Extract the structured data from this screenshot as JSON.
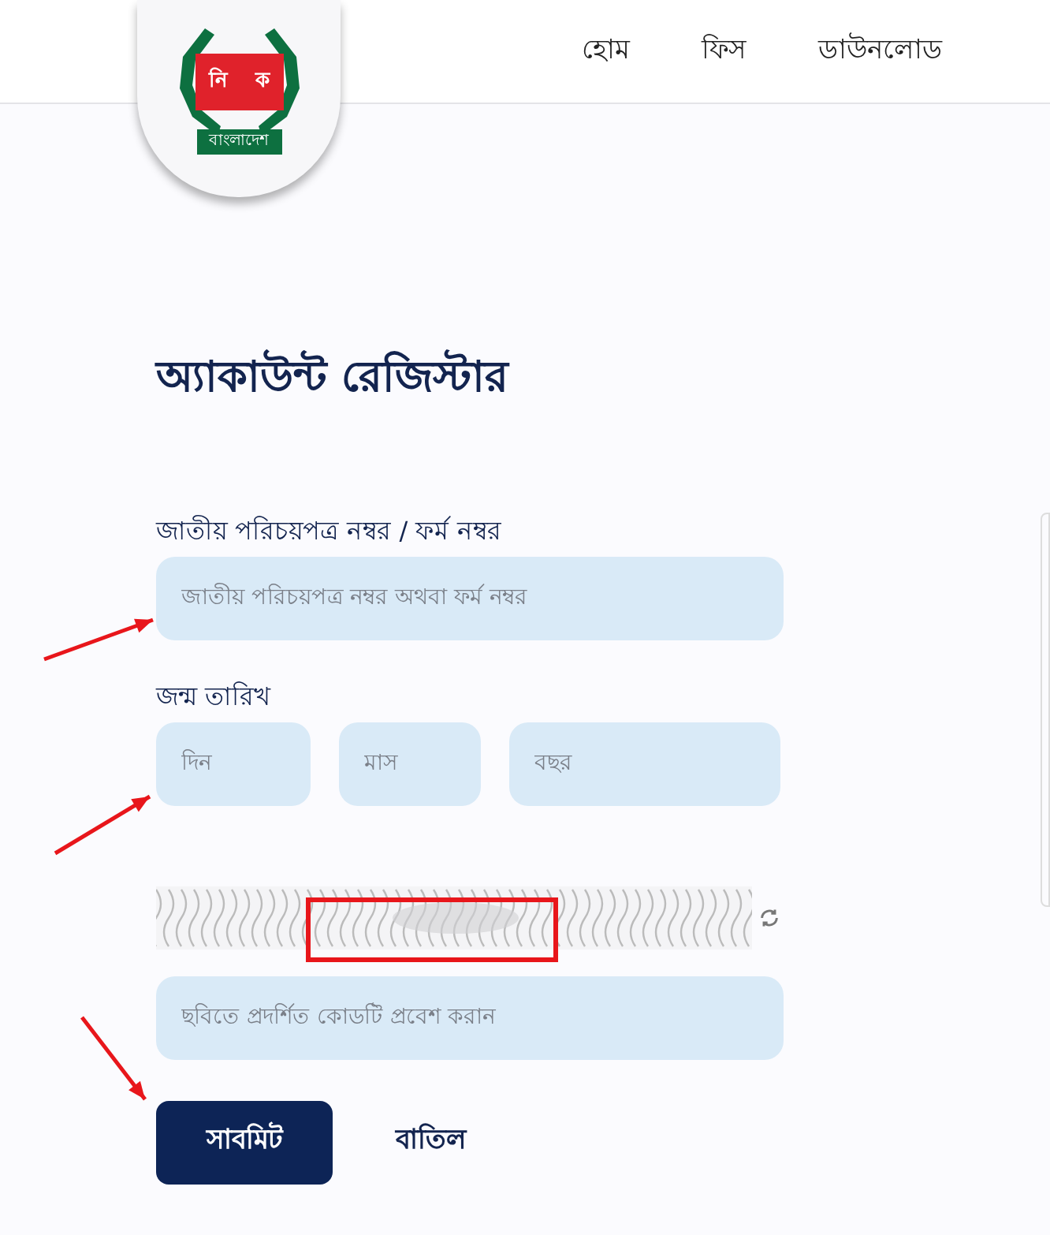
{
  "logo": {
    "box_letters": [
      "নি",
      "ক"
    ],
    "ribbon": "বাংলাদেশ"
  },
  "nav": [
    {
      "label": "হোম"
    },
    {
      "label": "ফিস"
    },
    {
      "label": "ডাউনলোড"
    }
  ],
  "title": "অ্যাকাউন্ট রেজিস্টার",
  "id_field": {
    "label": "জাতীয় পরিচয়পত্র নম্বর / ফর্ম নম্বর",
    "placeholder": "জাতীয় পরিচয়পত্র নম্বর অথবা ফর্ম নম্বর"
  },
  "birth_date": {
    "label": "জন্ম তারিখ",
    "fields": [
      {
        "placeholder": "দিন"
      },
      {
        "placeholder": "মাস"
      },
      {
        "placeholder": "বছর"
      }
    ]
  },
  "captcha": {
    "kind": "picture",
    "placeholder": "ছবিতে প্রদর্শিত কোডটি প্রবেশ করান"
  },
  "buttons": [
    {
      "label": "সাবমিট",
      "kind": "primary"
    },
    {
      "label": "বাতিল",
      "kind": "link"
    }
  ]
}
